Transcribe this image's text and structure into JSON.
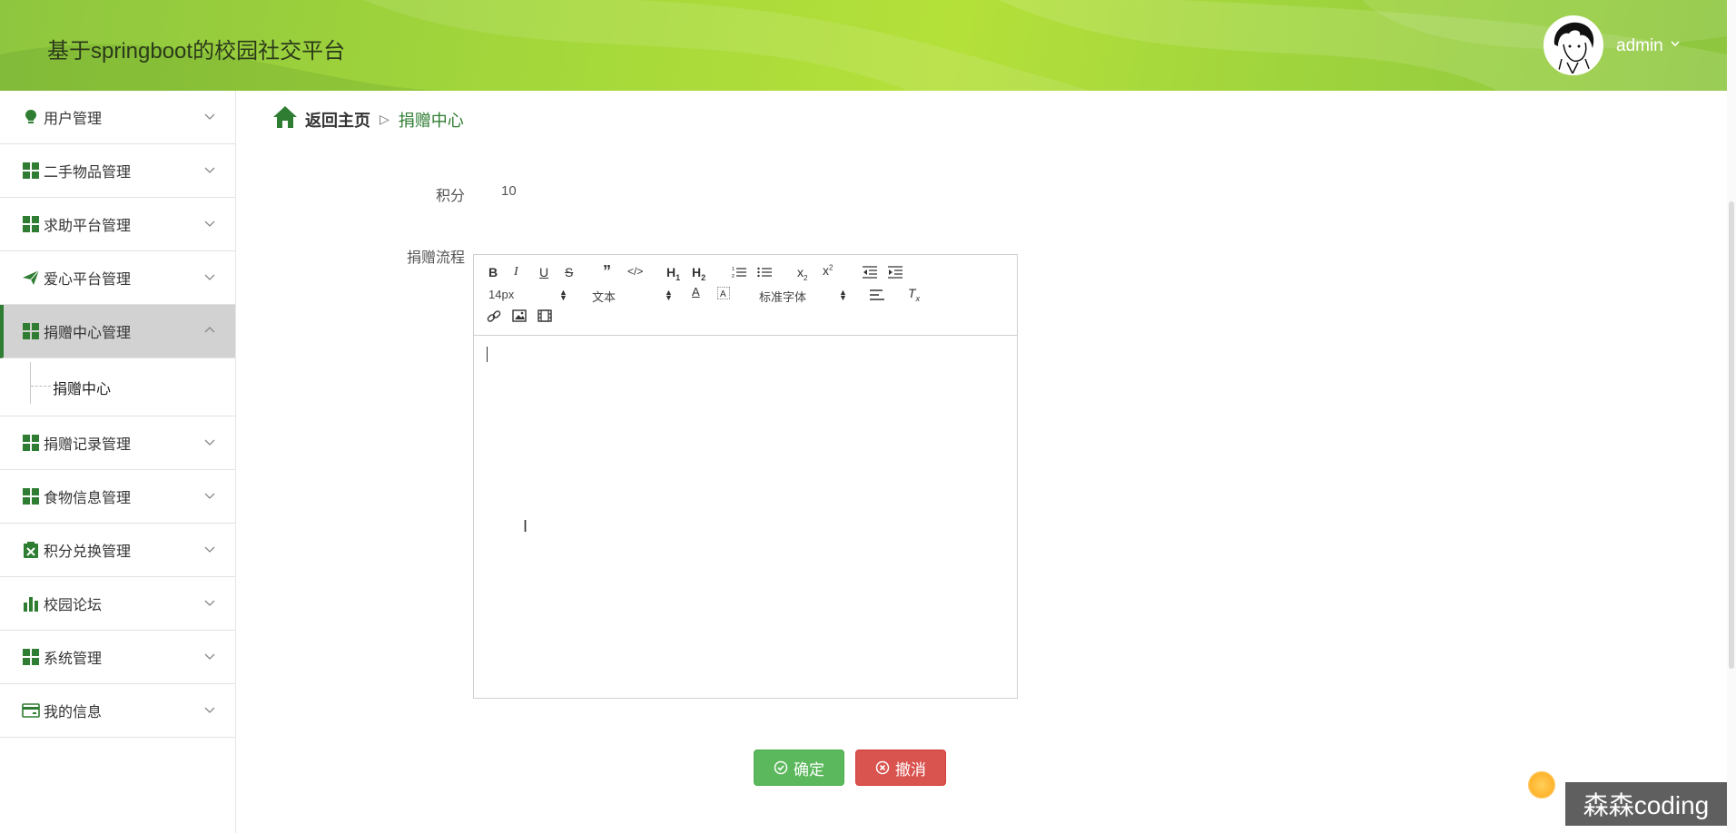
{
  "header": {
    "title": "基于springboot的校园社交平台",
    "username": "admin",
    "accent": "#a6d93a"
  },
  "sidebar": {
    "items": [
      {
        "label": "用户管理",
        "icon": "lightbulb-icon"
      },
      {
        "label": "二手物品管理",
        "icon": "grid-icon"
      },
      {
        "label": "求助平台管理",
        "icon": "grid-icon"
      },
      {
        "label": "爱心平台管理",
        "icon": "paper-plane-icon"
      },
      {
        "label": "捐赠中心管理",
        "icon": "grid-icon",
        "expanded": true
      },
      {
        "label": "捐赠记录管理",
        "icon": "grid-icon"
      },
      {
        "label": "食物信息管理",
        "icon": "grid-icon"
      },
      {
        "label": "积分兑换管理",
        "icon": "clipboard-icon"
      },
      {
        "label": "校园论坛",
        "icon": "bar-chart-icon"
      },
      {
        "label": "系统管理",
        "icon": "grid-icon"
      },
      {
        "label": "我的信息",
        "icon": "card-icon"
      }
    ],
    "submenu": {
      "label": "捐赠中心"
    }
  },
  "breadcrumb": {
    "home": "返回主页",
    "separator": "▷",
    "current": "捐赠中心"
  },
  "form": {
    "points_label": "积分",
    "points_value": "10",
    "process_label": "捐赠流程"
  },
  "editor": {
    "font_size": "14px",
    "block_format": "文本",
    "font_family": "标准字体"
  },
  "buttons": {
    "ok": "确定",
    "cancel": "撤消"
  },
  "watermark": "森森coding"
}
